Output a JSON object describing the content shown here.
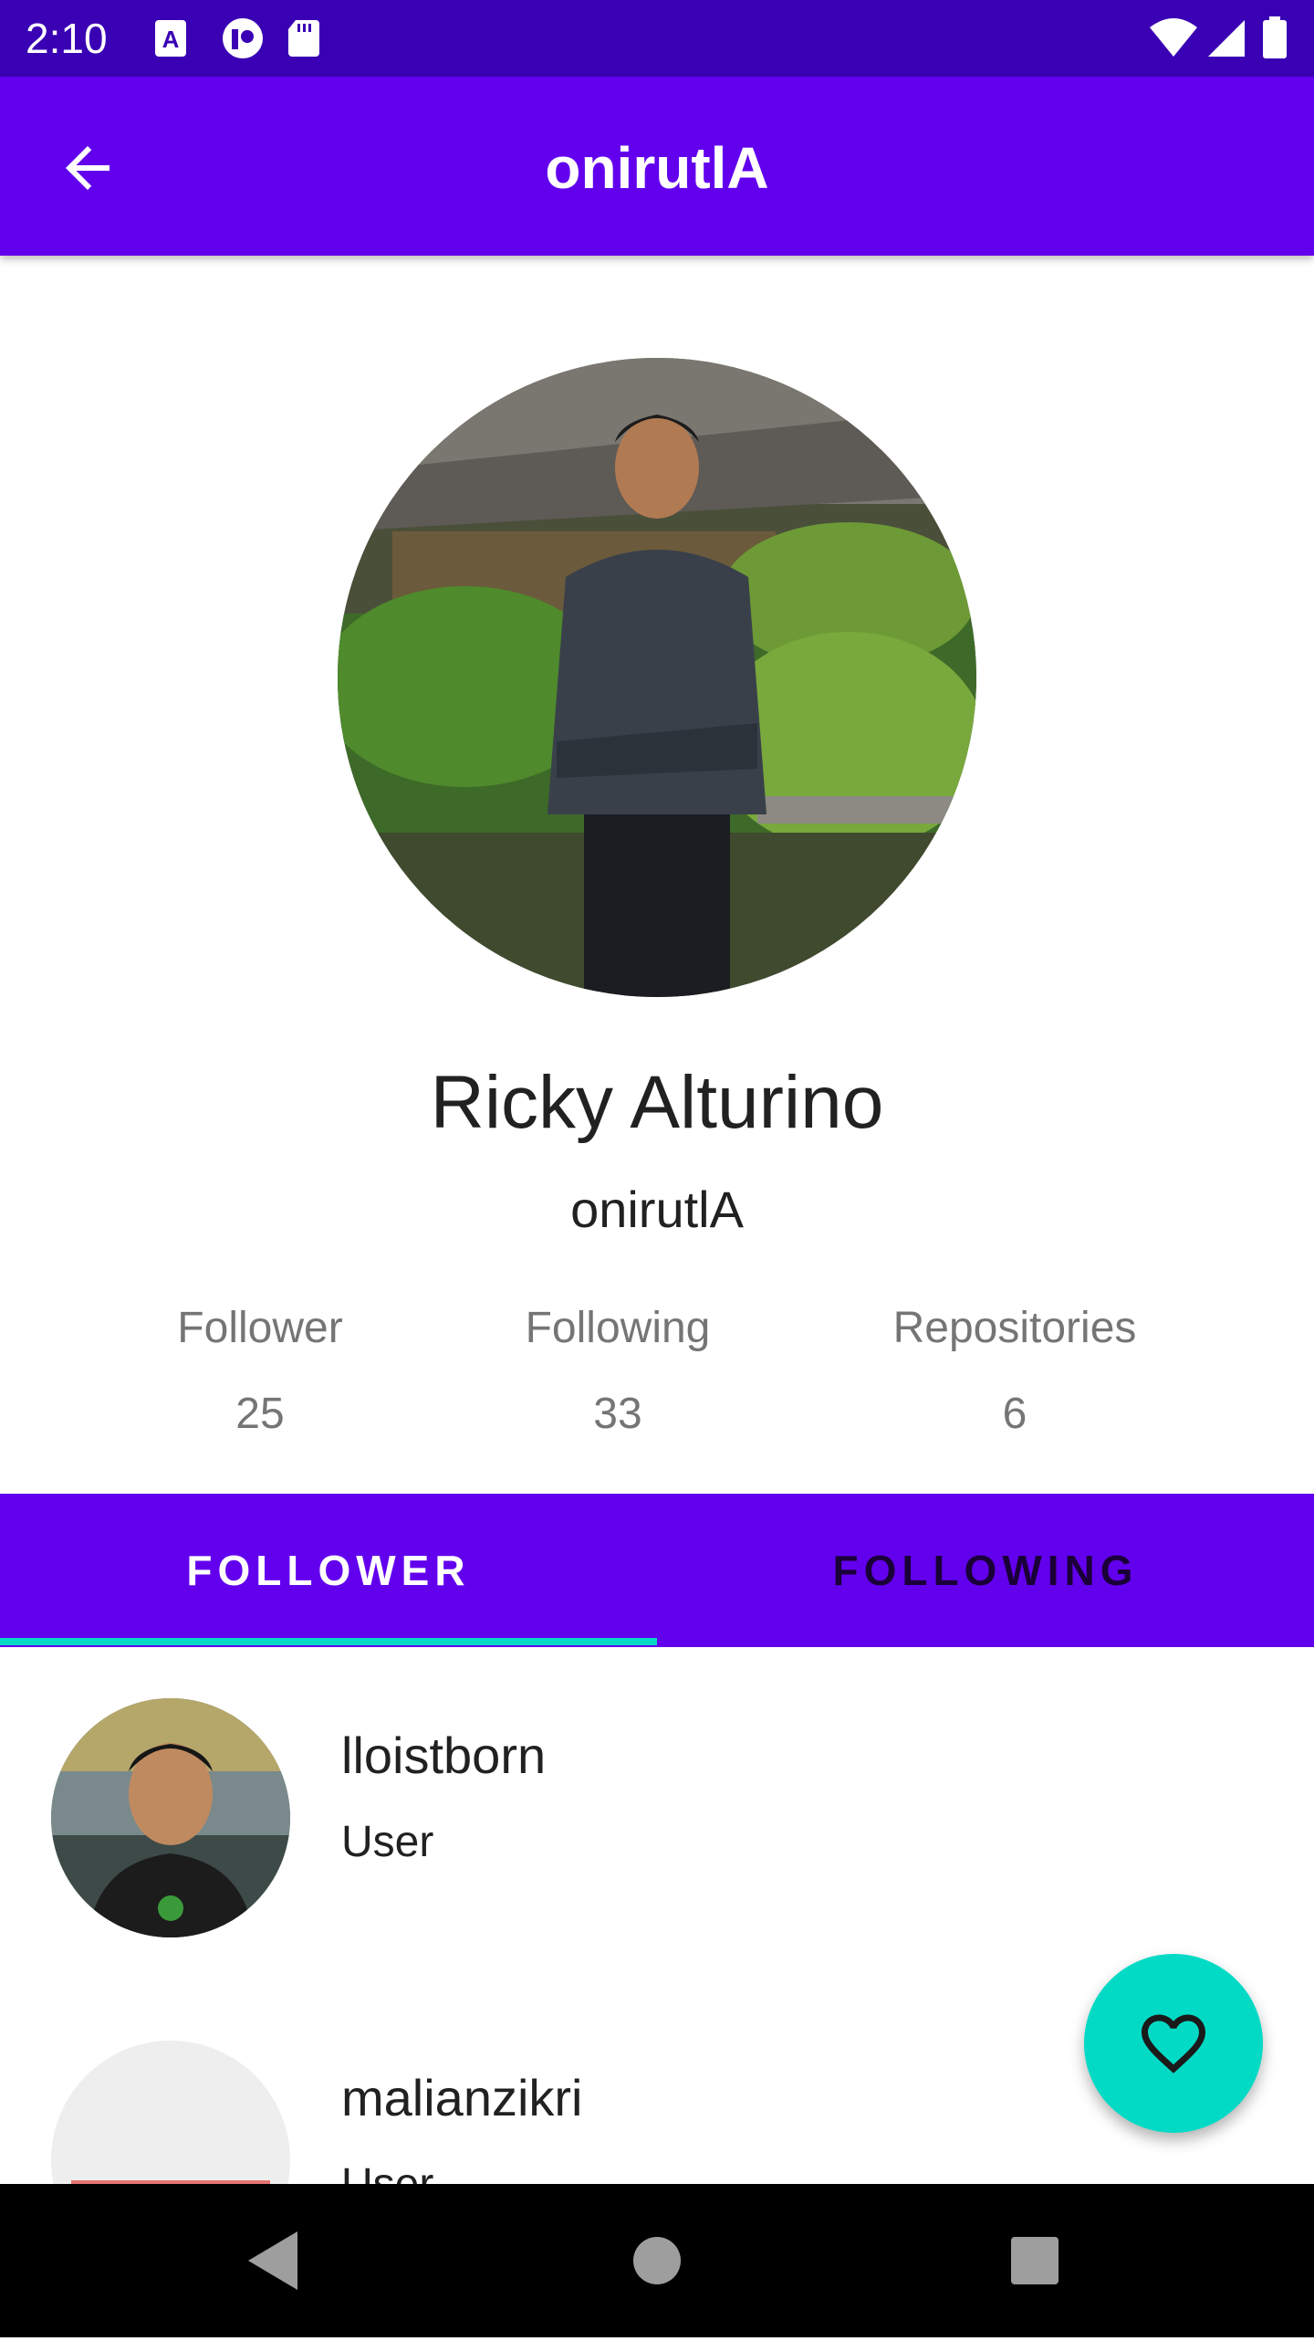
{
  "status_bar": {
    "time": "2:10",
    "icons": [
      "keyboard-a-icon",
      "app-badge-icon",
      "sd-card-icon",
      "wifi-icon",
      "signal-icon",
      "battery-icon"
    ]
  },
  "app_bar": {
    "title": "onirutlA",
    "back_icon": "arrow-back-icon"
  },
  "profile": {
    "name": "Ricky Alturino",
    "username": "onirutlA",
    "stats": [
      {
        "label": "Follower",
        "value": "25"
      },
      {
        "label": "Following",
        "value": "33"
      },
      {
        "label": "Repositories",
        "value": "6"
      }
    ]
  },
  "tabs": [
    {
      "label": "FOLLOWER",
      "active": true
    },
    {
      "label": "FOLLOWING",
      "active": false
    }
  ],
  "list": [
    {
      "login": "lloistborn",
      "type": "User"
    },
    {
      "login": "malianzikri",
      "type": "User"
    }
  ],
  "fab": {
    "icon": "heart-outline-icon"
  },
  "colors": {
    "status_bar": "#3a00b4",
    "primary": "#6200ee",
    "accent": "#03dac5"
  }
}
